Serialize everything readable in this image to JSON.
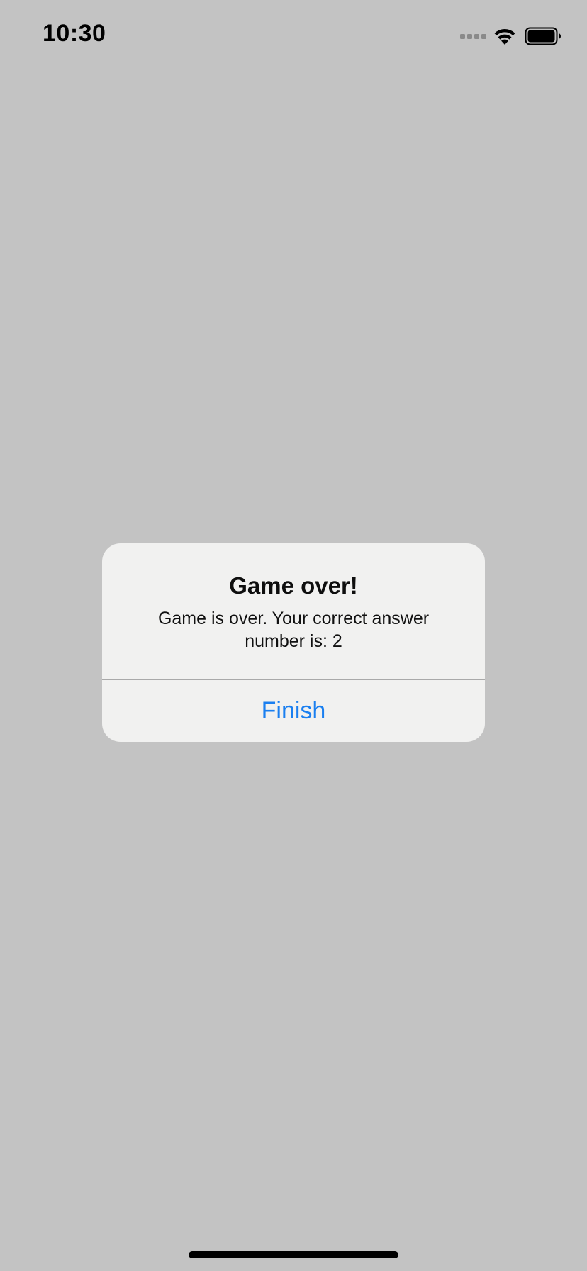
{
  "status_bar": {
    "time": "10:30",
    "icons": [
      "cellular-signal-icon",
      "wifi-icon",
      "battery-icon"
    ]
  },
  "alert": {
    "title": "Game over!",
    "message": "Game is over. Your correct answer number is: 2",
    "button_label": "Finish"
  },
  "colors": {
    "background": "#c3c3c3",
    "alert_background": "#f1f1f0",
    "button_text": "#1a7ff0",
    "divider": "#a9a9a9"
  }
}
